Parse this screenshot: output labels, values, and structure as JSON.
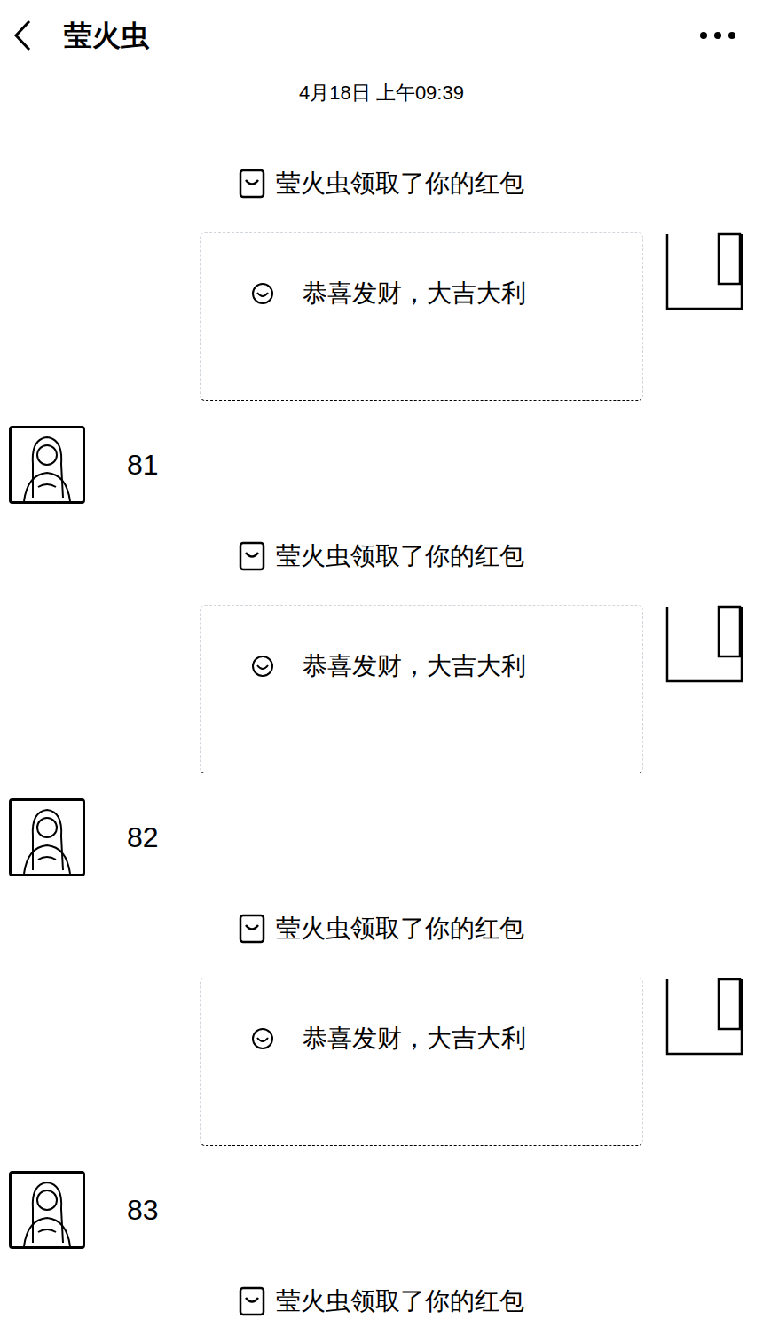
{
  "header": {
    "title": "莹火虫"
  },
  "timestamp": "4月18日 上午09:39",
  "messages": [
    {
      "kind": "system",
      "text": "莹火虫领取了你的红包"
    },
    {
      "kind": "redpacket",
      "text": "恭喜发财，大吉大利"
    },
    {
      "kind": "text",
      "text": "81"
    },
    {
      "kind": "system",
      "text": "莹火虫领取了你的红包"
    },
    {
      "kind": "redpacket",
      "text": "恭喜发财，大吉大利"
    },
    {
      "kind": "text",
      "text": "82"
    },
    {
      "kind": "system",
      "text": "莹火虫领取了你的红包"
    },
    {
      "kind": "redpacket",
      "text": "恭喜发财，大吉大利"
    },
    {
      "kind": "text",
      "text": "83"
    },
    {
      "kind": "system",
      "text": "莹火虫领取了你的红包"
    }
  ]
}
